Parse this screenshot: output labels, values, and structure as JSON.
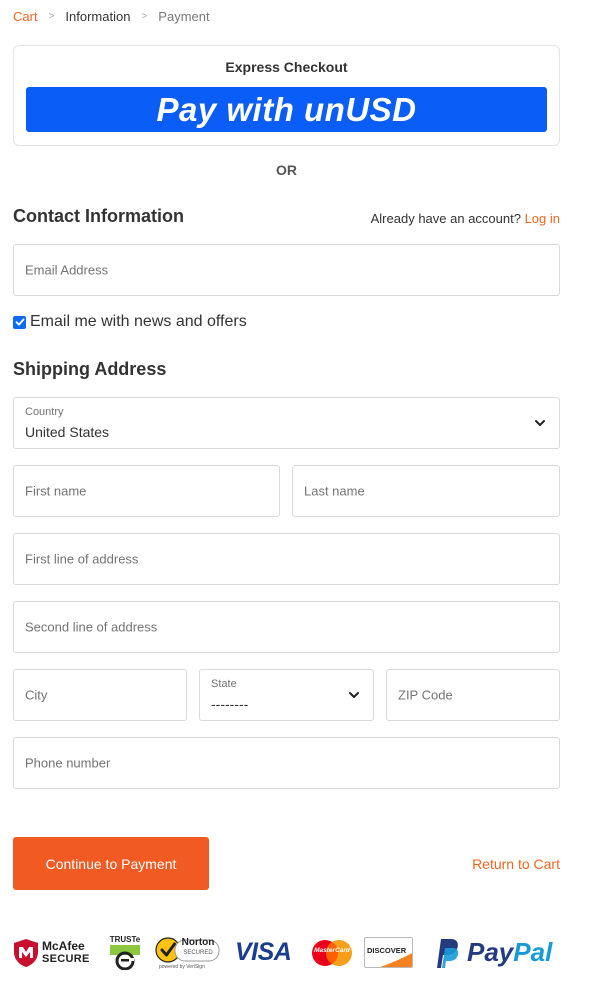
{
  "breadcrumb": {
    "items": [
      {
        "label": "Cart",
        "state": "link"
      },
      {
        "label": "Information",
        "state": "current"
      },
      {
        "label": "Payment",
        "state": "upcoming"
      }
    ],
    "separator": ">"
  },
  "express": {
    "title": "Express Checkout",
    "pay_button": "Pay with unUSD"
  },
  "divider": "OR",
  "contact": {
    "title": "Contact Information",
    "account_prompt": "Already have an account?",
    "login_link": "Log in",
    "email_placeholder": "Email Address",
    "newsletter_label": "Email me with news and offers",
    "newsletter_checked": true
  },
  "shipping": {
    "title": "Shipping Address",
    "country_label": "Country",
    "country_value": "United States",
    "first_name_placeholder": "First name",
    "last_name_placeholder": "Last name",
    "address1_placeholder": "First line of address",
    "address2_placeholder": "Second line of address",
    "city_placeholder": "City",
    "state_label": "State",
    "state_value": "--------",
    "zip_placeholder": "ZIP Code",
    "phone_placeholder": "Phone number"
  },
  "actions": {
    "continue_label": "Continue to Payment",
    "return_label": "Return to Cart"
  },
  "trust_badges": {
    "mcafee_top": "McAfee",
    "mcafee_bottom": "SECURE",
    "truste": "TRUSTe",
    "norton_top": "Norton",
    "norton_sub": "SECURED",
    "norton_powered": "powered by VeriSign",
    "visa": "VISA",
    "mastercard": "MasterCard",
    "discover": "DISCOVER",
    "paypal_pay": "Pay",
    "paypal_pal": "Pal"
  },
  "colors": {
    "accent": "#f26522",
    "button": "#f15a22",
    "express_blue": "#0a5ef7",
    "checkbox_blue": "#0a6cf5",
    "border": "#d9d9d9"
  }
}
